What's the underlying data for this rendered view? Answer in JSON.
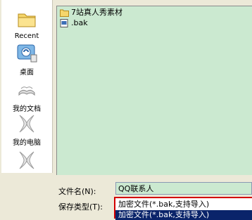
{
  "places": [
    {
      "label": "Recent",
      "icon": "recent-folder-icon"
    },
    {
      "label": "桌面",
      "icon": "desktop-icon"
    },
    {
      "label": "我的文档",
      "icon": "my-documents-icon"
    },
    {
      "label": "我的电脑",
      "icon": "my-computer-icon"
    },
    {
      "label": "",
      "icon": "network-places-icon"
    }
  ],
  "files": [
    {
      "name": "7站真人秀素材",
      "icon": "folder-icon"
    },
    {
      "name": ".bak",
      "icon": "bak-file-icon"
    }
  ],
  "form": {
    "filename_label": "文件名(N):",
    "filename_value": "QQ联系人",
    "type_label": "保存类型(T):",
    "type_selected": "加密文件(*.bak,支持导入)",
    "type_highlight": "加密文件(*.bak,支持导入)"
  },
  "colors": {
    "list_bg": "#cbe9d0",
    "highlight": "#0a246a",
    "outline": "#d20000"
  }
}
